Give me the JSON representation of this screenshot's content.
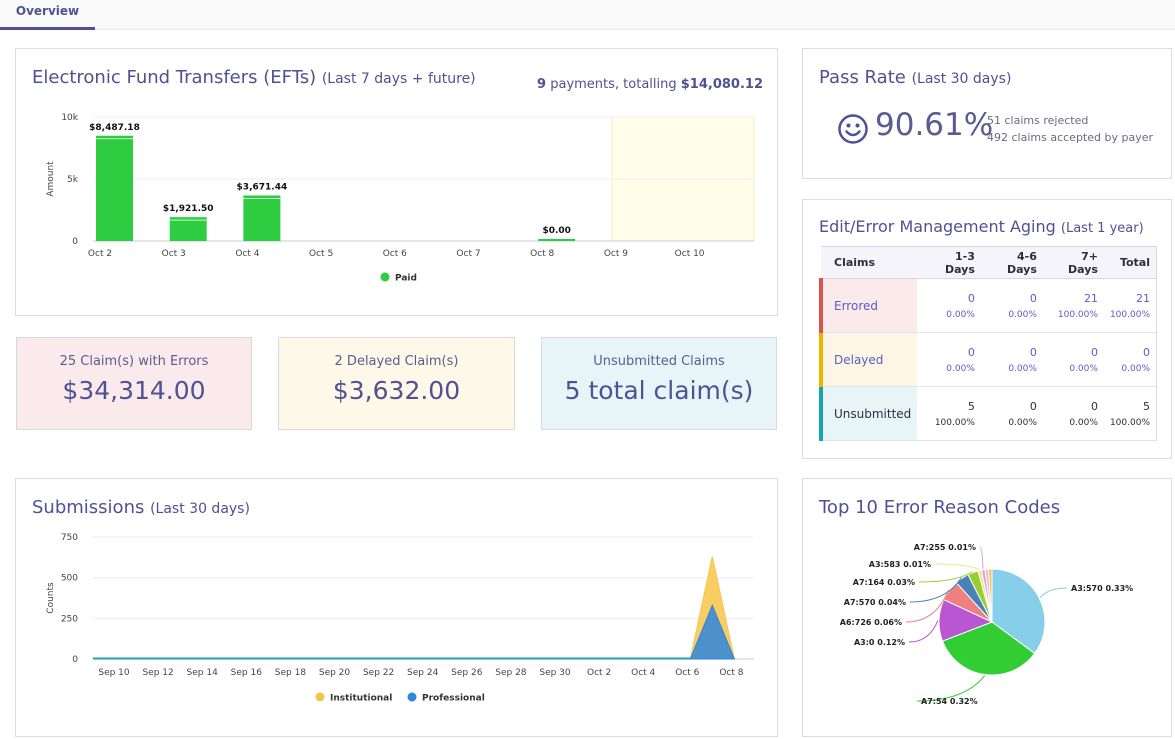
{
  "tabs": [
    {
      "label": "Overview",
      "active": true
    }
  ],
  "eft": {
    "title": "Electronic Fund Transfers (EFTs)",
    "subtitle": "(Last 7 days + future)",
    "payments_count": "9",
    "payments_text": " payments, totalling ",
    "payments_total": "$14,080.12"
  },
  "stats": {
    "errors": {
      "label": "25 Claim(s) with Errors",
      "value": "$34,314.00",
      "bg": "#fbeaec"
    },
    "delayed": {
      "label": "2 Delayed Claim(s)",
      "value": "$3,632.00",
      "bg": "#fef8e8"
    },
    "unsubmitted": {
      "label": "Unsubmitted Claims",
      "value": "5 total claim(s)",
      "bg": "#e8f5f8"
    }
  },
  "submissions": {
    "title": "Submissions",
    "subtitle": "(Last 30 days)"
  },
  "pass_rate": {
    "title": "Pass Rate",
    "subtitle": "(Last 30 days)",
    "icon": "smiley-icon",
    "value": "90.61%",
    "rejected": "51 claims rejected",
    "accepted": "492 claims accepted by payer"
  },
  "aging": {
    "title": "Edit/Error Management Aging",
    "subtitle": "(Last 1 year)",
    "columns": [
      "Claims",
      "1-3 Days",
      "4-6 Days",
      "7+ Days",
      "Total"
    ],
    "rows": [
      {
        "label": "Errored",
        "cells": [
          {
            "n": "0",
            "p": "0.00%"
          },
          {
            "n": "0",
            "p": "0.00%"
          },
          {
            "n": "21",
            "p": "100.00%"
          },
          {
            "n": "21",
            "p": "100.00%"
          }
        ]
      },
      {
        "label": "Delayed",
        "cells": [
          {
            "n": "0",
            "p": "0.00%"
          },
          {
            "n": "0",
            "p": "0.00%"
          },
          {
            "n": "0",
            "p": "0.00%"
          },
          {
            "n": "0",
            "p": "0.00%"
          }
        ]
      },
      {
        "label": "Unsubmitted",
        "cells": [
          {
            "n": "5",
            "p": "100.00%"
          },
          {
            "n": "0",
            "p": "0.00%"
          },
          {
            "n": "0",
            "p": "0.00%"
          },
          {
            "n": "5",
            "p": "100.00%"
          }
        ]
      }
    ]
  },
  "error_codes": {
    "title": "Top 10 Error Reason Codes"
  },
  "chart_data": [
    {
      "type": "bar",
      "ylabel": "Amount",
      "yticks": [
        "0",
        "5k",
        "10k"
      ],
      "ylim": [
        0,
        10000
      ],
      "categories": [
        "Oct 2",
        "Oct 3",
        "Oct 4",
        "Oct 5",
        "Oct 6",
        "Oct 7",
        "Oct 8",
        "Oct 9",
        "Oct 10"
      ],
      "series": [
        {
          "name": "Paid",
          "color": "#2ecc40",
          "values": [
            8487.18,
            1921.5,
            3671.44,
            null,
            null,
            null,
            0.0,
            null,
            null
          ]
        }
      ],
      "data_labels": [
        "$8,487.18",
        "$1,921.50",
        "$3,671.44",
        "",
        "",
        "",
        "$0.00",
        "",
        ""
      ],
      "future_shaded_from": "Oct 9",
      "legend_placement": "bottom-center"
    },
    {
      "type": "area",
      "ylabel": "Counts",
      "yticks": [
        "0",
        "250",
        "500",
        "750"
      ],
      "ylim": [
        0,
        750
      ],
      "xtick_labels": [
        "Sep 10",
        "Sep 12",
        "Sep 14",
        "Sep 16",
        "Sep 18",
        "Sep 20",
        "Sep 22",
        "Sep 24",
        "Sep 26",
        "Sep 28",
        "Sep 30",
        "Oct 2",
        "Oct 4",
        "Oct 6",
        "Oct 8"
      ],
      "x": [
        "Oct 6",
        "Oct 7",
        "Oct 8"
      ],
      "series": [
        {
          "name": "Institutional",
          "color": "#f7c548",
          "values": [
            0,
            630,
            0
          ]
        },
        {
          "name": "Professional",
          "color": "#2e86de",
          "values": [
            0,
            330,
            0
          ]
        }
      ],
      "legend_placement": "bottom-center"
    },
    {
      "type": "pie",
      "slices": [
        {
          "label": "A3:570 0.33%",
          "value": 0.33,
          "color": "#87ceeb"
        },
        {
          "label": "A7:54 0.32%",
          "value": 0.32,
          "color": "#32cd32"
        },
        {
          "label": "A3:0 0.12%",
          "value": 0.12,
          "color": "#ba55d3"
        },
        {
          "label": "A6:726 0.06%",
          "value": 0.06,
          "color": "#f08080"
        },
        {
          "label": "A7:570 0.04%",
          "value": 0.04,
          "color": "#4682b4"
        },
        {
          "label": "A7:164 0.03%",
          "value": 0.03,
          "color": "#9acd32"
        },
        {
          "label": "A3:583 0.01%",
          "value": 0.01,
          "color": "#f0e68c"
        },
        {
          "label": "A7:255 0.01%",
          "value": 0.01,
          "color": "#dda0dd"
        },
        {
          "label": "",
          "value": 0.01,
          "color": "#ffb6c1"
        },
        {
          "label": "",
          "value": 0.01,
          "color": "#e9c46a"
        }
      ]
    }
  ]
}
